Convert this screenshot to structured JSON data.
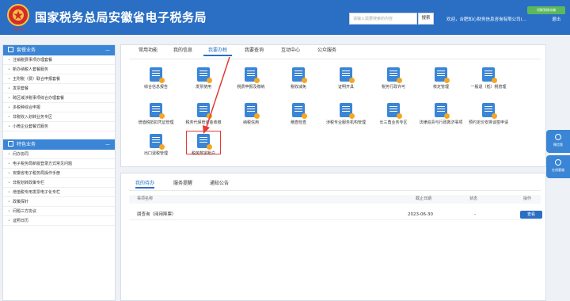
{
  "header": {
    "title": "国家税务总局安徽省电子税务局",
    "logo_text": "中国税务",
    "search_placeholder": "请输入需要搜索的内容",
    "search_button": "搜索",
    "switch_button": "切换到移动端",
    "welcome": "欢迎，合肥知心财务信息咨询有限公司(...",
    "logout": "退出"
  },
  "sidebar": {
    "sections": [
      {
        "title": "套餐业务",
        "toggle": "—",
        "items": [
          "注销税费事项办理套餐",
          "新办纳税人套餐服务",
          "主附税（费）联合申报套餐",
          "发票套餐",
          "跨区域涉税事项综合办理套餐",
          "多税种综合申报",
          "非税收入划转业务专区",
          "小微企业套餐式服务"
        ]
      },
      {
        "title": "特色业务",
        "toggle": "—",
        "items": [
          "问办协同",
          "电子税务局新版登录方式常见问题",
          "安徽省电子税务局操作手册",
          "非税划转政策专栏",
          "增值税专用发票电子化专栏",
          "政策探针",
          "问题三方协议",
          "证照日历"
        ]
      }
    ]
  },
  "main": {
    "tabs": [
      "常用功能",
      "我的信息",
      "我要办税",
      "我要查询",
      "互动中心",
      "公众服务"
    ],
    "active_tab": "我要办税",
    "functions": [
      "综合信息报告",
      "发票使用",
      "税费申报及缴纳",
      "税收减免",
      "证明开具",
      "税务行政许可",
      "核定管理",
      "一般退（抵）税管理",
      "增值税抵扣凭证管理",
      "税务代保管资金收缴",
      "纳税信用",
      "稽查检查",
      "涉税专业服务机构管理",
      "长三角业务专区",
      "法律追责与行政救济事项",
      "预约定价安排谈签申请",
      "出口退税管理",
      "税务数字账户"
    ]
  },
  "lower": {
    "tabs": [
      "我的待办",
      "服务提醒",
      "通知公告"
    ],
    "active_tab": "我的待办",
    "columns": [
      "事项名称",
      "截止日期",
      "状态",
      "操作"
    ],
    "rows": [
      {
        "name": "朋查询（阅用降票）",
        "deadline": "2023-06-30",
        "status": "-",
        "action": "查看"
      }
    ]
  },
  "floating": [
    "微信版",
    "在线客服"
  ],
  "colors": {
    "brand": "#2a6fc4",
    "highlight": "#e53935",
    "icon_accent": "#f5a623"
  }
}
